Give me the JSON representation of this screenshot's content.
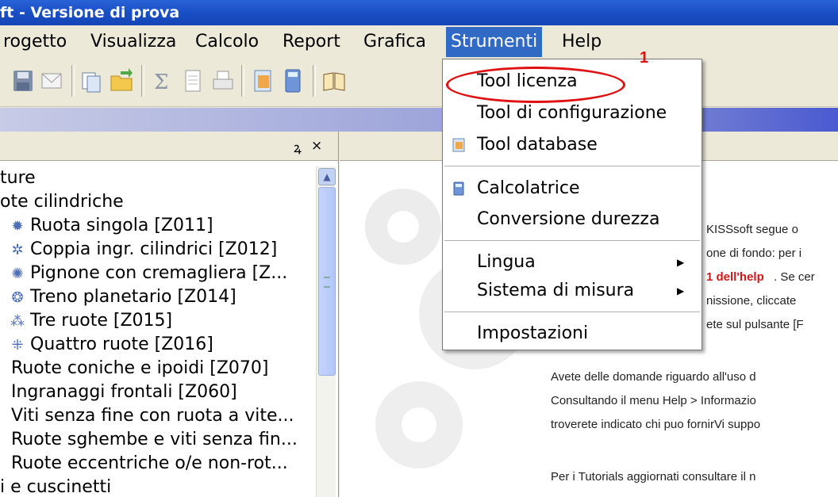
{
  "window": {
    "title": "ft - Versione di prova"
  },
  "menubar": {
    "items": [
      "rogetto",
      "Visualizza",
      "Calcolo",
      "Report",
      "Grafica",
      "Strumenti",
      "Help"
    ],
    "active": "Strumenti"
  },
  "toolbar": {
    "icons": [
      "save-icon",
      "mail-icon",
      "copy-icon",
      "open-folder-icon",
      "sum-icon",
      "document-icon",
      "print-icon",
      "database-icon",
      "calculator-icon",
      "book-icon"
    ]
  },
  "left_panel": {
    "controls": {
      "pin": "ꝝ",
      "close": "×"
    },
    "tree": [
      {
        "label": "ture",
        "icon": ""
      },
      {
        "label": "ote cilindriche",
        "icon": ""
      },
      {
        "label": "Ruota singola [Z011]",
        "icon": "single-gear-icon"
      },
      {
        "label": "Coppia ingr. cilindrici [Z012]",
        "icon": "gear-pair-icon"
      },
      {
        "label": "Pignone con cremagliera [Z...",
        "icon": "rack-pinion-icon"
      },
      {
        "label": "Treno planetario [Z014]",
        "icon": "planetary-icon"
      },
      {
        "label": "Tre ruote [Z015]",
        "icon": "three-gears-icon"
      },
      {
        "label": "Quattro ruote [Z016]",
        "icon": "four-gears-icon"
      },
      {
        "label": "Ruote coniche e ipoidi [Z070]",
        "icon": ""
      },
      {
        "label": "Ingranaggi frontali  [Z060]",
        "icon": ""
      },
      {
        "label": "Viti senza fine con ruota a vite...",
        "icon": ""
      },
      {
        "label": "Ruote sghembe e viti senza fin...",
        "icon": ""
      },
      {
        "label": "Ruote eccentriche o/e non-rot...",
        "icon": ""
      },
      {
        "label": "i e cuscinetti",
        "icon": ""
      }
    ]
  },
  "right_panel": {
    "lines": [
      {
        "text": "KISSsoft segue o",
        "red": false
      },
      {
        "text": "one di fondo: per i",
        "red": false
      },
      {
        "text": "1 dell'help",
        "red": true
      },
      {
        "text": ". Se cer",
        "red": false
      },
      {
        "text": "nissione, cliccate",
        "red": false
      },
      {
        "text": "ete sul pulsante [F",
        "red": false
      },
      {
        "text": "Avete delle domande riguardo all'uso d",
        "red": false
      },
      {
        "text": "Consultando il menu Help > Informazio",
        "red": false
      },
      {
        "text": "troverete indicato chi puo fornirVi suppo",
        "red": false
      },
      {
        "text": "Per i Tutorials aggiornati consultare il n",
        "red": false
      }
    ]
  },
  "strumenti_menu": {
    "items": [
      {
        "label": "Tool licenza",
        "icon": "",
        "submenu": false
      },
      {
        "label": "Tool di configurazione",
        "icon": "",
        "submenu": false
      },
      {
        "label": "Tool database",
        "icon": "database-icon",
        "submenu": false
      },
      {
        "label": "Calcolatrice",
        "icon": "calculator-icon",
        "submenu": false
      },
      {
        "label": "Conversione durezza",
        "icon": "",
        "submenu": false
      },
      {
        "label": "Lingua",
        "icon": "",
        "submenu": true
      },
      {
        "label": "Sistema di misura",
        "icon": "",
        "submenu": true
      },
      {
        "label": "Impostazioni",
        "icon": "",
        "submenu": false
      }
    ],
    "submenu_arrow": "▶",
    "highlighted": "Tool licenza"
  },
  "annotation": {
    "number": "1",
    "color": "#e01010"
  }
}
